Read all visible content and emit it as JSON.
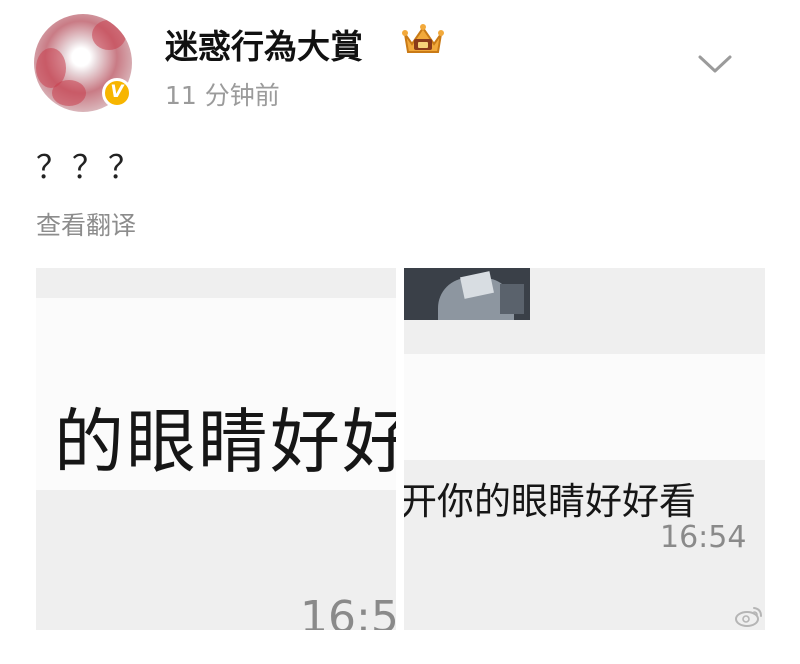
{
  "post": {
    "username": "迷惑行為大賞",
    "timestamp": "11 分钟前",
    "text": "？？？",
    "translate_label": "查看翻译"
  },
  "images": [
    {
      "chat_text": "的眼睛好好",
      "time": "16:5"
    },
    {
      "chat_text": "开你的眼睛好好看",
      "time": "16:54"
    }
  ],
  "icons": {
    "verified_badge": "V",
    "crown": "crown-badge-icon",
    "chevron": "chevron-down-icon",
    "watermark": "weibo-watermark-icon"
  },
  "colors": {
    "verified": "#f7b500",
    "secondary_text": "#9b9b9b",
    "image_background": "#efefef"
  }
}
